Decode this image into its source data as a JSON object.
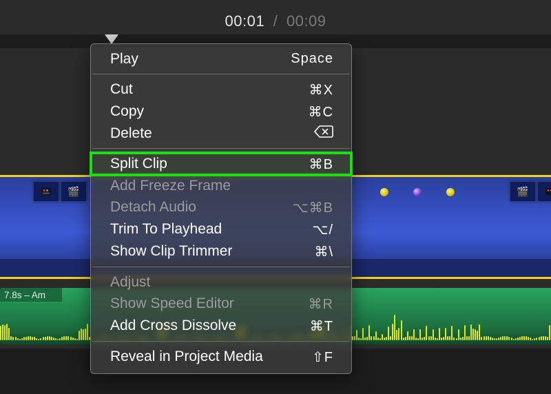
{
  "time": {
    "current": "00:01",
    "separator": "/",
    "total": "00:09"
  },
  "audio": {
    "label": "7.8s – Am"
  },
  "menu": {
    "groups": [
      [
        {
          "key": "play",
          "label": "Play",
          "shortcut": "Space",
          "enabled": true
        }
      ],
      [
        {
          "key": "cut",
          "label": "Cut",
          "shortcut": "⌘X",
          "enabled": true
        },
        {
          "key": "copy",
          "label": "Copy",
          "shortcut": "⌘C",
          "enabled": true
        },
        {
          "key": "delete",
          "label": "Delete",
          "shortcut": "⌫",
          "enabled": true,
          "icon": "backspace"
        }
      ],
      [
        {
          "key": "split-clip",
          "label": "Split Clip",
          "shortcut": "⌘B",
          "enabled": true,
          "highlight": true
        },
        {
          "key": "add-freeze-frame",
          "label": "Add Freeze Frame",
          "shortcut": "",
          "enabled": false
        },
        {
          "key": "detach-audio",
          "label": "Detach Audio",
          "shortcut": "⌥⌘B",
          "enabled": false
        },
        {
          "key": "trim-to-playhead",
          "label": "Trim To Playhead",
          "shortcut": "⌥/",
          "enabled": true
        },
        {
          "key": "show-clip-trimmer",
          "label": "Show Clip Trimmer",
          "shortcut": "⌘\\",
          "enabled": true
        }
      ],
      [
        {
          "key": "adjust",
          "label": "Adjust",
          "shortcut": "",
          "enabled": false
        },
        {
          "key": "show-speed-editor",
          "label": "Show Speed Editor",
          "shortcut": "⌘R",
          "enabled": false
        },
        {
          "key": "add-cross-dissolve",
          "label": "Add Cross Dissolve",
          "shortcut": "⌘T",
          "enabled": true
        }
      ],
      [
        {
          "key": "reveal-in-project-media",
          "label": "Reveal in Project Media",
          "shortcut": "⇧F",
          "enabled": true
        }
      ]
    ]
  }
}
